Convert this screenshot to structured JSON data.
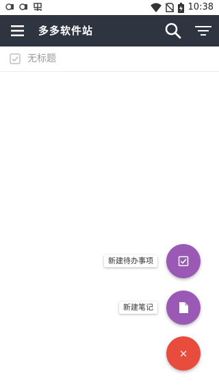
{
  "status_bar": {
    "time": "10:38",
    "left_icons": [
      "app-notification-icon",
      "app-notification-icon",
      "bug-icon"
    ],
    "right_icons": [
      "wifi-icon",
      "no-sim-icon",
      "battery-icon"
    ]
  },
  "app_bar": {
    "title": "多多软件站",
    "background": "#2f3441",
    "icons": [
      "menu-icon",
      "search-icon",
      "filter-icon"
    ]
  },
  "list": {
    "items": [
      {
        "title": "无标题",
        "icon": "checkbox-checked-icon"
      }
    ]
  },
  "fab_menu": {
    "todo_label": "新建待办事项",
    "note_label": "新建笔记",
    "close_symbol": "×",
    "todo_color": "#9b59b6",
    "note_color": "#9b59b6",
    "close_color": "#e74c3c"
  }
}
